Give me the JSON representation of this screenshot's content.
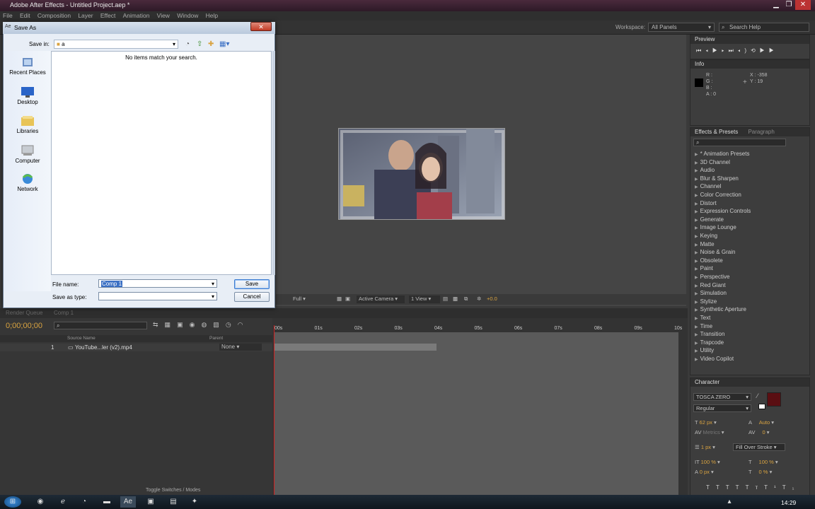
{
  "window": {
    "title": "Adobe After Effects - Untitled Project.aep *"
  },
  "menu": [
    "File",
    "Edit",
    "Composition",
    "Layer",
    "Effect",
    "Animation",
    "View",
    "Window",
    "Help"
  ],
  "toolbar": {
    "workspace_label": "Workspace:",
    "workspace_value": "All Panels",
    "search_placeholder": "Search Help"
  },
  "preview": {
    "tab": "Preview"
  },
  "info": {
    "tab": "Info",
    "r": "R :",
    "g": "G :",
    "b": "B :",
    "a": "A : 0",
    "x": "X : -358",
    "y": "Y : 19"
  },
  "effects": {
    "tabs": [
      "Effects & Presets",
      "Paragraph"
    ],
    "items": [
      "* Animation Presets",
      "3D Channel",
      "Audio",
      "Blur & Sharpen",
      "Channel",
      "Color Correction",
      "Distort",
      "Expression Controls",
      "Generate",
      "Image Lounge",
      "Keying",
      "Matte",
      "Noise & Grain",
      "Obsolete",
      "Paint",
      "Perspective",
      "Red Giant",
      "Simulation",
      "Stylize",
      "Synthetic Aperture",
      "Text",
      "Time",
      "Transition",
      "Trapcode",
      "Utility",
      "Video Copilot"
    ]
  },
  "character": {
    "tab": "Character",
    "font": "TOSCA ZERO",
    "style": "Regular",
    "size": "62 px",
    "leading": "Auto",
    "kerning": "Metrics",
    "tracking": "0",
    "stroke": "1 px",
    "stroke_mode": "Fill Over Stroke",
    "vscale": "100 %",
    "hscale": "100 %",
    "baseline": "0 px",
    "tsume": "0 %",
    "style_buttons": [
      "T",
      "T",
      "TT",
      "Tт",
      "T¹",
      "T₁"
    ],
    "fill_color": "#5a0e12"
  },
  "viewer": {
    "zoom": "Full",
    "camera": "Active Camera",
    "view": "1 View",
    "exposure": "+0.0"
  },
  "timeline": {
    "tabs": [
      "Render Queue",
      "Comp 1"
    ],
    "timecode": "0;00;00;00",
    "columns": {
      "source": "Source Name",
      "parent": "Parent"
    },
    "layer": {
      "index": "1",
      "name": "YouTube...ler (v2).mp4",
      "parent": "None"
    },
    "ruler": [
      "00s",
      "01s",
      "02s",
      "03s",
      "04s",
      "05s",
      "06s",
      "07s",
      "08s",
      "09s",
      "10s"
    ],
    "footer": "Toggle Switches / Modes"
  },
  "dialog": {
    "title": "Save As",
    "save_in_label": "Save in:",
    "save_in_value": "a",
    "empty_message": "No items match your search.",
    "places": [
      "Recent Places",
      "Desktop",
      "Libraries",
      "Computer",
      "Network"
    ],
    "filename_label": "File name:",
    "filename_value": "Comp 1",
    "filetype_label": "Save as type:",
    "filetype_value": "",
    "save_label": "Save",
    "cancel_label": "Cancel"
  },
  "taskbar": {
    "clock": "14:29"
  }
}
